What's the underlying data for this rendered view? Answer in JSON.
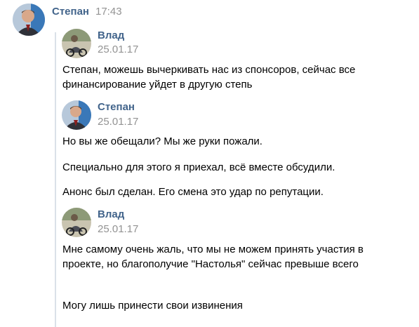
{
  "header": {
    "author": "Степан",
    "time": "17:43"
  },
  "forwarded": [
    {
      "author": "Влад",
      "date": "25.01.17",
      "avatar": "vlad-avatar",
      "lines": [
        "Степан, можешь вычеркивать нас из спонсоров, сейчас все финансирование уйдет в другую степь"
      ]
    },
    {
      "author": "Степан",
      "date": "25.01.17",
      "avatar": "stepan-avatar",
      "lines": [
        "Но вы же обещали? Мы же руки пожали.",
        "Специально для этого я приехал, всё вместе обсудили.",
        "Анонс был сделан. Его смена это удар по репутации."
      ]
    },
    {
      "author": "Влад",
      "date": "25.01.17",
      "avatar": "vlad-avatar",
      "lines": [
        "Мне самому очень жаль, что мы не можем принять участия в проекте, но благополучие \"Настолья\" сейчас превыше всего",
        "Могу лишь принести свои извинения"
      ]
    }
  ],
  "colors": {
    "author": "#42648b",
    "time": "#939393",
    "bar": "#dae1e8"
  }
}
